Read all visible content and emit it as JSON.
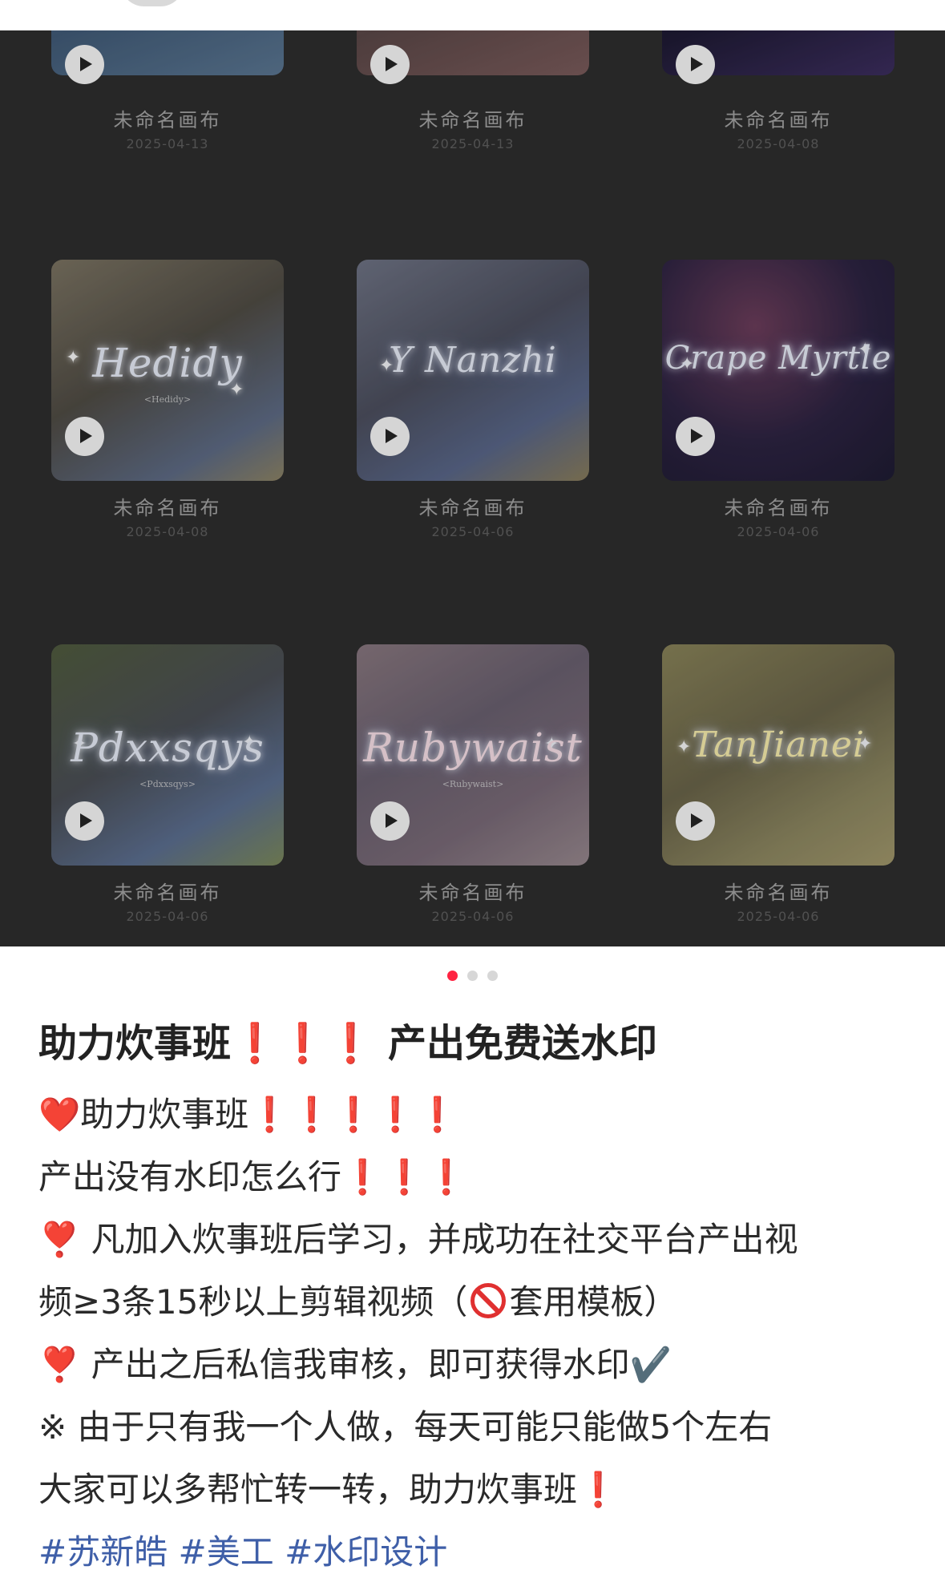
{
  "gallery": {
    "tiles": [
      {
        "title": "未命名画布",
        "date": "2025-04-13",
        "script": "",
        "sub": ""
      },
      {
        "title": "未命名画布",
        "date": "2025-04-13",
        "script": "",
        "sub": ""
      },
      {
        "title": "未命名画布",
        "date": "2025-04-08",
        "script": "",
        "sub": ""
      },
      {
        "title": "未命名画布",
        "date": "2025-04-08",
        "script": "Hedidy",
        "sub": "<Hedidy>"
      },
      {
        "title": "未命名画布",
        "date": "2025-04-06",
        "script": "Y Nanzhi",
        "sub": ""
      },
      {
        "title": "未命名画布",
        "date": "2025-04-06",
        "script": "Crape Myrtle",
        "sub": ""
      },
      {
        "title": "未命名画布",
        "date": "2025-04-06",
        "script": "Pdxxsqys",
        "sub": "<Pdxxsqys>"
      },
      {
        "title": "未命名画布",
        "date": "2025-04-06",
        "script": "Rubywaist",
        "sub": "<Rubywaist>"
      },
      {
        "title": "未命名画布",
        "date": "2025-04-06",
        "script": "TanJianei",
        "sub": ""
      }
    ]
  },
  "carousel": {
    "count": 3,
    "active": 0
  },
  "post": {
    "title_text": "助力炊事班",
    "title_marks": "❗️❗️❗️",
    "title_suffix": " 产出免费送水印",
    "line1_heart": "❤️",
    "line1_text": "助力炊事班",
    "line1_marks": "❗️❗️❗️❗️❗️",
    "line2_text": "产出没有水印怎么行",
    "line2_marks": "❗️❗️❗️",
    "line3_mark": "❣️",
    "line3_text": "凡加入炊事班后学习，并成功在社交平台产出视",
    "line4_text_a": "频≥3条15秒以上剪辑视频（",
    "line4_text_b": "套用模板）",
    "line5_mark": "❣️",
    "line5_text": "产出之后私信我审核，即可获得水印✔️",
    "line6_text": "※ 由于只有我一个人做，每天可能只能做5个左右",
    "line7_text": "大家可以多帮忙转一转，助力炊事班",
    "line7_mark": "❗️",
    "hashtags": "#苏新皓 #美工 #水印设计"
  },
  "colors": {
    "accent": "#ff2442",
    "exclaim": "#e02020",
    "hashtag": "#3f5fa8",
    "gallery_bg": "#2b2b2b"
  }
}
